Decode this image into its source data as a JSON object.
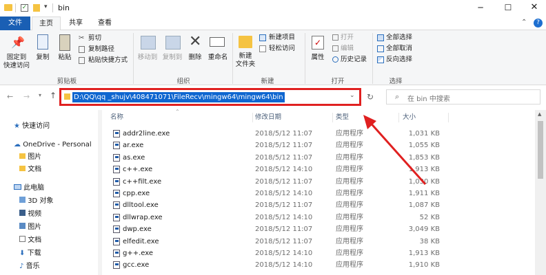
{
  "window": {
    "title": "bin"
  },
  "tabs": [
    {
      "label": "文件"
    },
    {
      "label": "主页"
    },
    {
      "label": "共享"
    },
    {
      "label": "查看"
    }
  ],
  "ribbon": {
    "pin": "固定到\n快速访问",
    "copy": "复制",
    "paste": "粘贴",
    "cut": "剪切",
    "copy_path": "复制路径",
    "paste_shortcut": "粘贴快捷方式",
    "clipboard": "剪贴板",
    "move_to": "移动到",
    "copy_to": "复制到",
    "delete": "删除",
    "rename": "重命名",
    "organize": "组织",
    "new_folder": "新建\n文件夹",
    "new_item": "新建项目",
    "easy_access": "轻松访问",
    "new": "新建",
    "properties": "属性",
    "open": "打开",
    "edit": "编辑",
    "history": "历史记录",
    "open_group": "打开",
    "select_all": "全部选择",
    "select_none": "全部取消",
    "invert": "反向选择",
    "select": "选择"
  },
  "address": {
    "path": "D:\\QQ\\qq _shujv\\408471071\\FileRecv\\mingw64\\mingw64\\bin"
  },
  "search": {
    "placeholder": "在 bin 中搜索"
  },
  "nav": [
    {
      "label": "快速访问"
    },
    {
      "label": "OneDrive - Personal"
    },
    {
      "label": "图片"
    },
    {
      "label": "文档"
    },
    {
      "label": "此电脑"
    },
    {
      "label": "3D 对象"
    },
    {
      "label": "视频"
    },
    {
      "label": "图片"
    },
    {
      "label": "文档"
    },
    {
      "label": "下载"
    },
    {
      "label": "音乐"
    }
  ],
  "columns": {
    "name": "名称",
    "date": "修改日期",
    "type": "类型",
    "size": "大小"
  },
  "files": [
    {
      "name": "addr2line.exe",
      "date": "2018/5/12 11:07",
      "type": "应用程序",
      "size": "1,031 KB"
    },
    {
      "name": "ar.exe",
      "date": "2018/5/12 11:07",
      "type": "应用程序",
      "size": "1,055 KB"
    },
    {
      "name": "as.exe",
      "date": "2018/5/12 11:07",
      "type": "应用程序",
      "size": "1,853 KB"
    },
    {
      "name": "c++.exe",
      "date": "2018/5/12 14:10",
      "type": "应用程序",
      "size": "1,913 KB"
    },
    {
      "name": "c++filt.exe",
      "date": "2018/5/12 11:07",
      "type": "应用程序",
      "size": "1,030 KB"
    },
    {
      "name": "cpp.exe",
      "date": "2018/5/12 14:10",
      "type": "应用程序",
      "size": "1,911 KB"
    },
    {
      "name": "dlltool.exe",
      "date": "2018/5/12 11:07",
      "type": "应用程序",
      "size": "1,087 KB"
    },
    {
      "name": "dllwrap.exe",
      "date": "2018/5/12 14:10",
      "type": "应用程序",
      "size": "52 KB"
    },
    {
      "name": "dwp.exe",
      "date": "2018/5/12 11:07",
      "type": "应用程序",
      "size": "3,049 KB"
    },
    {
      "name": "elfedit.exe",
      "date": "2018/5/12 11:07",
      "type": "应用程序",
      "size": "38 KB"
    },
    {
      "name": "g++.exe",
      "date": "2018/5/12 14:10",
      "type": "应用程序",
      "size": "1,913 KB"
    },
    {
      "name": "gcc.exe",
      "date": "2018/5/12 14:10",
      "type": "应用程序",
      "size": "1,910 KB"
    }
  ],
  "colors": {
    "accent": "#1e5aa8",
    "annotation": "#e02020",
    "selection": "#0f66d0"
  }
}
